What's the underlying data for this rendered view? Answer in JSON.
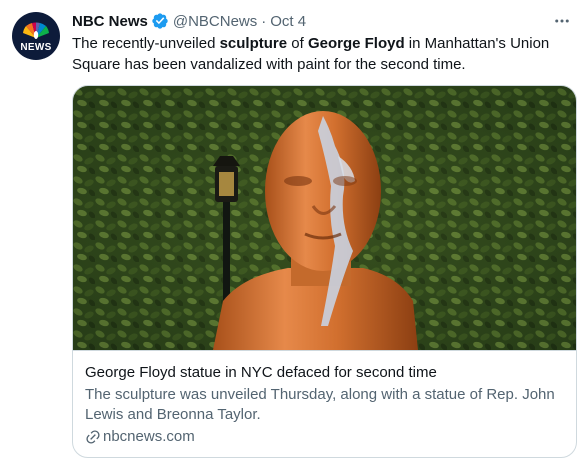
{
  "tweet": {
    "author": {
      "display_name": "NBC News",
      "handle": "@NBCNews",
      "avatar_text": "NEWS",
      "verified_icon": "verified-badge-icon"
    },
    "separator": "·",
    "date": "Oct 4",
    "more_icon": "more-horizontal-icon",
    "text": {
      "part1": "The recently-unveiled ",
      "bold1": "sculpture",
      "part2": " of ",
      "bold2": "George Floyd",
      "part3": " in Manhattan's Union Square has been vandalized with paint for the second time."
    },
    "card": {
      "title": "George Floyd statue in NYC defaced for second time",
      "description": "The sculpture was unveiled Thursday, along with a statue of Rep. John Lewis and Breonna Taylor.",
      "domain": "nbcnews.com",
      "link_icon": "link-icon"
    }
  },
  "colors": {
    "text_primary": "#0f1419",
    "text_secondary": "#536471",
    "verified_blue": "#1d9bf0",
    "border": "#cfd9de",
    "avatar_bg": "#0d1b3a"
  }
}
